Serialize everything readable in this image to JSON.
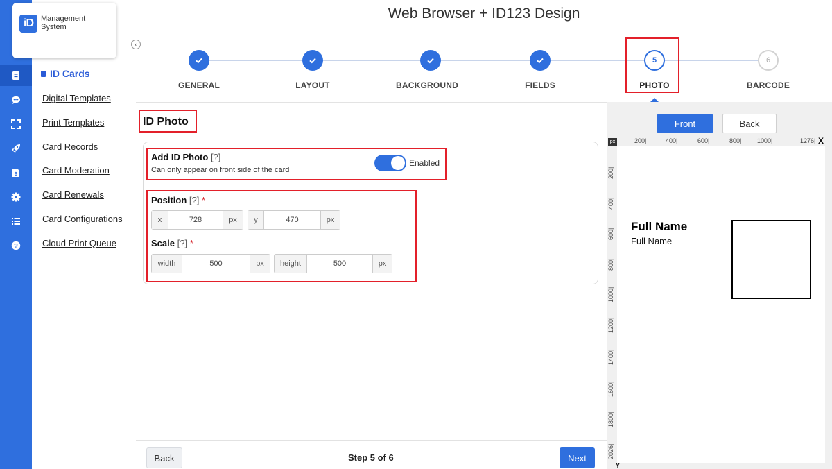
{
  "logo": {
    "mark": "iD",
    "text": "Management\nSystem"
  },
  "rail_icons": [
    "id-card-icon",
    "chat-icon",
    "expand-icon",
    "rocket-icon",
    "invoice-icon",
    "gear-icon",
    "list-icon",
    "help-icon"
  ],
  "sidebar": {
    "heading": "ID Cards",
    "links": [
      "Digital Templates",
      "Print Templates",
      "Card Records",
      "Card Moderation",
      "Card Renewals",
      "Card Configurations",
      "Cloud Print Queue"
    ]
  },
  "page_title": "Web Browser + ID123 Design",
  "stepper": {
    "steps": [
      {
        "label": "GENERAL",
        "state": "done"
      },
      {
        "label": "LAYOUT",
        "state": "done"
      },
      {
        "label": "BACKGROUND",
        "state": "done"
      },
      {
        "label": "FIELDS",
        "state": "done"
      },
      {
        "label": "PHOTO",
        "state": "current",
        "number": "5"
      },
      {
        "label": "BARCODE",
        "state": "todo",
        "number": "6"
      }
    ]
  },
  "section_title": "ID Photo",
  "add_photo": {
    "label": "Add ID Photo",
    "help": "[?]",
    "note": "Can only appear on front side of the card",
    "toggle_label": "Enabled",
    "enabled": true
  },
  "position": {
    "label": "Position",
    "help": "[?]",
    "required": "*",
    "x_prefix": "x",
    "x_value": "728",
    "x_unit": "px",
    "y_prefix": "y",
    "y_value": "470",
    "y_unit": "px"
  },
  "scale": {
    "label": "Scale",
    "help": "[?]",
    "required": "*",
    "width_prefix": "width",
    "width_value": "500",
    "width_unit": "px",
    "height_prefix": "height",
    "height_value": "500",
    "height_unit": "px"
  },
  "footer": {
    "back_label": "Back",
    "step_text": "Step 5 of 6",
    "next_label": "Next"
  },
  "preview": {
    "front_label": "Front",
    "back_label": "Back",
    "ruler_unit": "px",
    "ruler_x_ticks": [
      "200",
      "400",
      "600",
      "800",
      "1000",
      "1276"
    ],
    "ruler_x_label": "X",
    "ruler_y_ticks": [
      "200",
      "400",
      "600",
      "800",
      "1000",
      "1200",
      "1400",
      "1600",
      "1800",
      "2026"
    ],
    "ruler_y_label": "Y",
    "card_name_bold": "Full Name",
    "card_name": "Full Name"
  },
  "colors": {
    "primary": "#2f6fde",
    "highlight": "#e3202a",
    "required": "#d6262d"
  }
}
